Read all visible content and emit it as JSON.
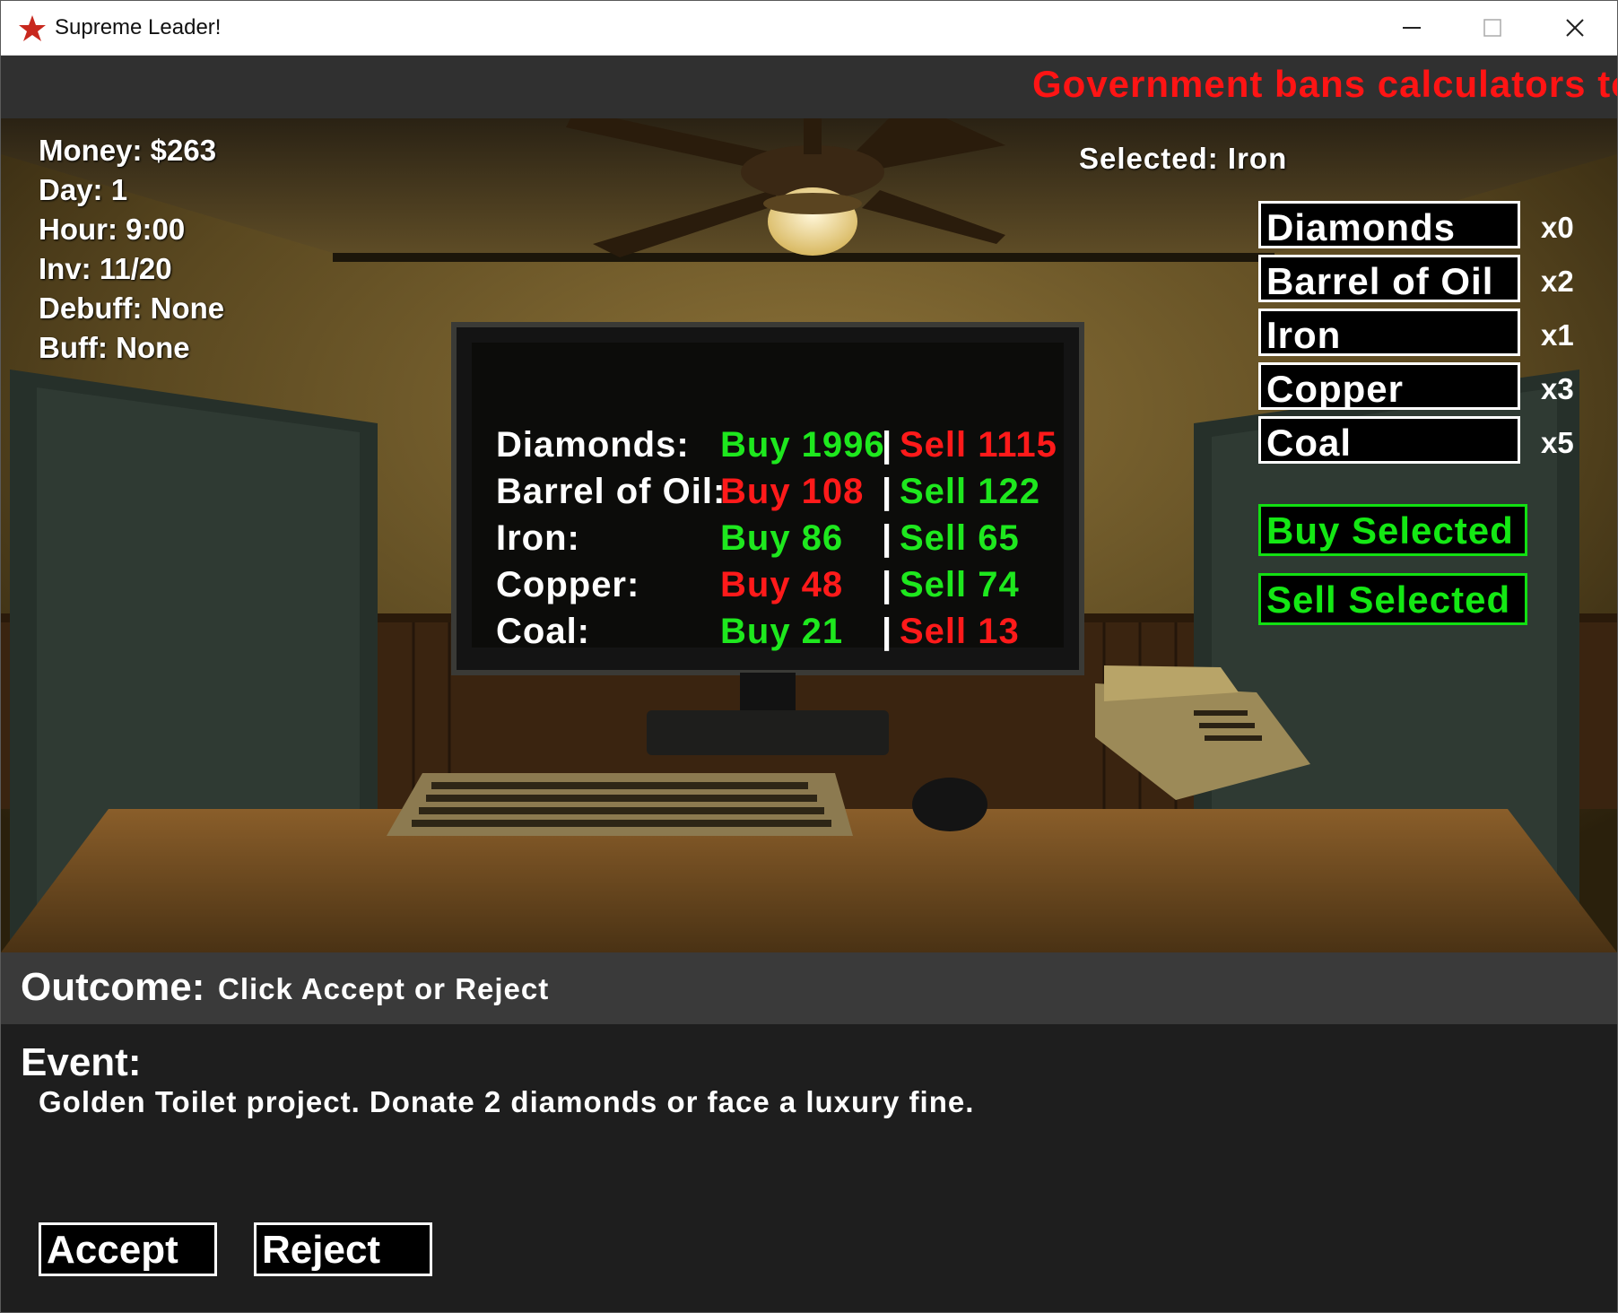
{
  "window": {
    "title": "Supreme Leader!",
    "icon": "red-star-icon"
  },
  "ticker": {
    "text": "Government bans calculators to s"
  },
  "hud": {
    "money": "Money: $263",
    "day": "Day: 1",
    "hour": "Hour: 9:00",
    "inv": "Inv: 11/20",
    "debuff": "Debuff: None",
    "buff": "Buff: None"
  },
  "selected": "Selected: Iron",
  "inventory": [
    {
      "name": "Diamonds",
      "count": "x0"
    },
    {
      "name": "Barrel of Oil",
      "count": "x2"
    },
    {
      "name": "Iron",
      "count": "x1"
    },
    {
      "name": "Copper",
      "count": "x3"
    },
    {
      "name": "Coal",
      "count": "x5"
    }
  ],
  "actions": {
    "buy": "Buy Selected",
    "sell": "Sell Selected"
  },
  "market": [
    {
      "name": "Diamonds:",
      "buy": "Buy 1996",
      "buy_color": "#1ee81e",
      "sep": "|",
      "sell": "Sell 1115",
      "sell_color": "#ff1a1a"
    },
    {
      "name": "Barrel of Oil:",
      "buy": "Buy 108",
      "buy_color": "#ff1a1a",
      "sep": "|",
      "sell": "Sell 122",
      "sell_color": "#1ee81e"
    },
    {
      "name": "Iron:",
      "buy": "Buy 86",
      "buy_color": "#1ee81e",
      "sep": "|",
      "sell": "Sell 65",
      "sell_color": "#1ee81e"
    },
    {
      "name": "Copper:",
      "buy": "Buy 48",
      "buy_color": "#ff1a1a",
      "sep": "|",
      "sell": "Sell 74",
      "sell_color": "#1ee81e"
    },
    {
      "name": "Coal:",
      "buy": "Buy 21",
      "buy_color": "#1ee81e",
      "sep": "|",
      "sell": "Sell 13",
      "sell_color": "#ff1a1a"
    }
  ],
  "outcome": {
    "label": "Outcome:",
    "value": "Click Accept or Reject"
  },
  "event": {
    "label": "Event:",
    "text": "Golden Toilet project. Donate 2 diamonds or face a luxury fine."
  },
  "choices": {
    "accept": "Accept",
    "reject": "Reject"
  },
  "colors": {
    "ticker": "#ff1414",
    "buy_button": "#14e814",
    "up": "#1ee81e",
    "down": "#ff1a1a"
  }
}
